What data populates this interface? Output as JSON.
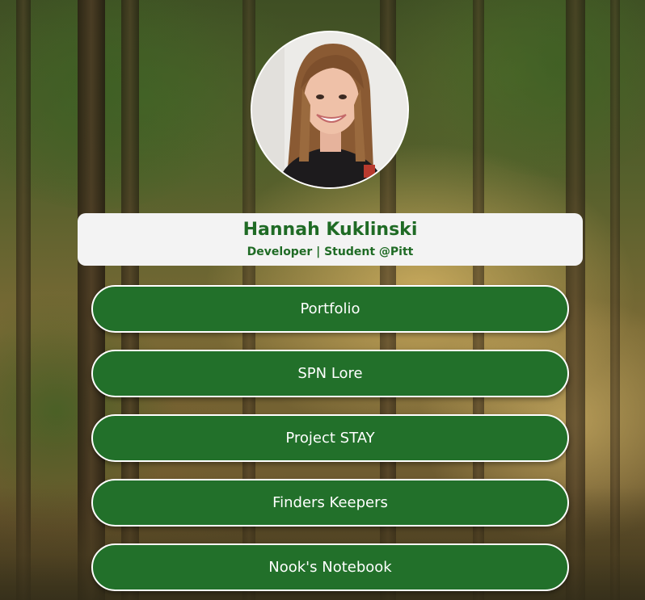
{
  "profile": {
    "name": "Hannah Kuklinski",
    "tagline": "Developer | Student @Pitt"
  },
  "links": [
    {
      "label": "Portfolio"
    },
    {
      "label": "SPN Lore"
    },
    {
      "label": "Project STAY"
    },
    {
      "label": "Finders Keepers"
    },
    {
      "label": "Nook's Notebook"
    }
  ],
  "colors": {
    "brand_green": "#22702a",
    "name_green": "#1f6b25",
    "card_background": "#f3f3f3",
    "button_border": "#ffffff",
    "button_text": "#ffffff"
  }
}
